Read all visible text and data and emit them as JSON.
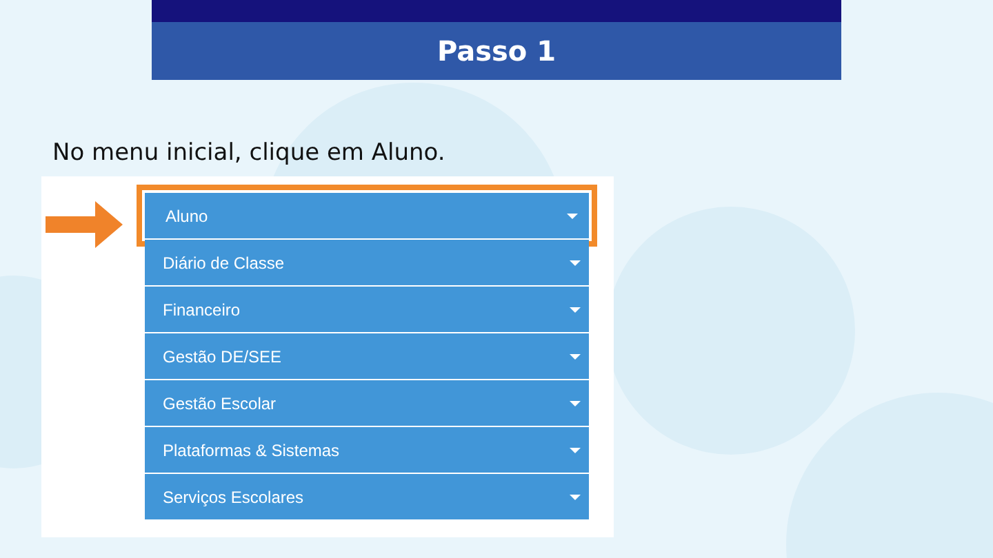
{
  "slide": {
    "title": "Passo 1",
    "instruction": "No menu inicial, clique em Aluno."
  },
  "menu": {
    "items": [
      {
        "label": "Aluno",
        "selected": true
      },
      {
        "label": "Diário de Classe",
        "selected": false
      },
      {
        "label": "Financeiro",
        "selected": false
      },
      {
        "label": "Gestão DE/SEE",
        "selected": false
      },
      {
        "label": "Gestão Escolar",
        "selected": false
      },
      {
        "label": "Plataformas & Sistemas",
        "selected": false
      },
      {
        "label": "Serviços Escolares",
        "selected": false
      }
    ]
  }
}
